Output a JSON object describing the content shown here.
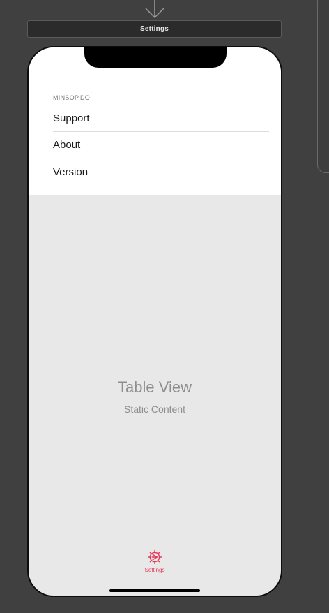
{
  "scene": {
    "title": "Settings"
  },
  "table": {
    "section_header": "MINSOP.DO",
    "rows": [
      {
        "label": "Support"
      },
      {
        "label": "About"
      },
      {
        "label": "Version"
      }
    ]
  },
  "placeholder": {
    "title": "Table View",
    "subtitle": "Static Content"
  },
  "tab_bar": {
    "items": [
      {
        "label": "Settings",
        "icon": "settings-gear-icon",
        "color": "#e8385a"
      }
    ]
  },
  "colors": {
    "accent": "#e8385a",
    "canvas_background": "#404040"
  }
}
